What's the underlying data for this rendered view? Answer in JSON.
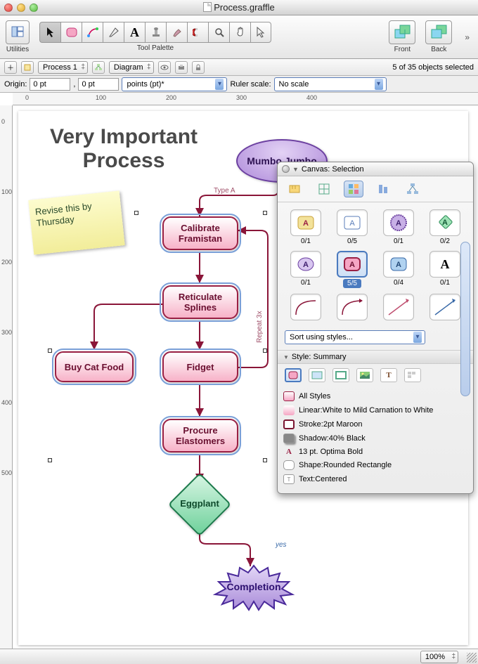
{
  "window": {
    "title": "Process.graffle"
  },
  "toolbar": {
    "utilities": "Utilities",
    "palette_label": "Tool Palette",
    "front": "Front",
    "back": "Back"
  },
  "secbar": {
    "canvas_popup": "Process 1",
    "layout_popup": "Diagram",
    "selection_status": "5 of 35 objects selected"
  },
  "originbar": {
    "label": "Origin:",
    "x": "0 pt",
    "y": "0 pt",
    "units": "points (pt)*",
    "scale_label": "Ruler scale:",
    "scale_value": "No scale"
  },
  "ruler_marks": {
    "h": [
      "0",
      "100",
      "200",
      "300",
      "400"
    ],
    "v": [
      "0",
      "100",
      "200",
      "300",
      "400",
      "500"
    ]
  },
  "canvas": {
    "headline_l1": "Very Important",
    "headline_l2": "Process",
    "sticky": "Revise this by Thursday",
    "nodes": {
      "mumbo": "Mumbo Jumbo",
      "calibrate": "Calibrate Framistan",
      "reticulate": "Reticulate Splines",
      "catfood": "Buy Cat Food",
      "fidget": "Fidget",
      "procure": "Procure Elastomers",
      "eggplant": "Eggplant",
      "completion": "Completion"
    },
    "labels": {
      "typea": "Type A",
      "repeat": "Repeat 3x",
      "yes": "yes"
    }
  },
  "inspector": {
    "title": "Canvas: Selection",
    "swatches": [
      {
        "count": "0/1"
      },
      {
        "count": "0/5"
      },
      {
        "count": "0/1"
      },
      {
        "count": "0/2"
      },
      {
        "count": "0/1"
      },
      {
        "count": "5/5",
        "selected": true
      },
      {
        "count": "0/4"
      },
      {
        "count": "0/1"
      }
    ],
    "sort_label": "Sort using styles...",
    "summary_hdr": "Style: Summary",
    "lines": {
      "all": "All Styles",
      "fill": "Linear:White to Mild Carnation to White",
      "stroke": "Stroke:2pt Maroon",
      "shadow": "Shadow:40% Black",
      "font": "13 pt. Optima Bold",
      "shape": "Shape:Rounded Rectangle",
      "text": "Text:Centered"
    }
  },
  "status": {
    "zoom": "100%"
  }
}
